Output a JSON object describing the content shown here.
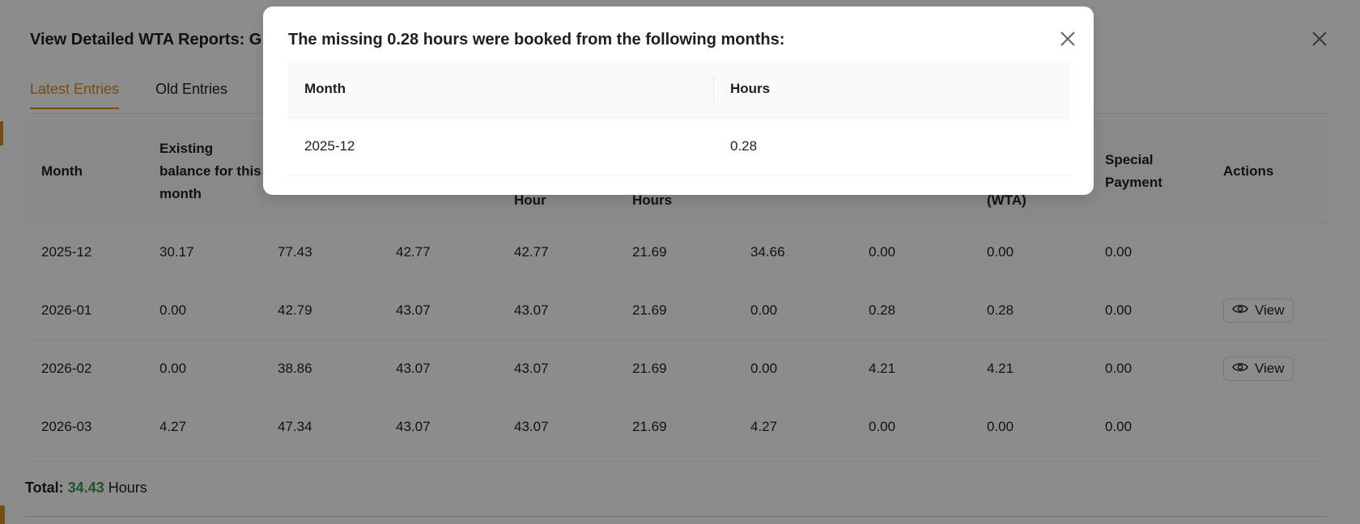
{
  "drawer": {
    "title": "View Detailed WTA Reports: G",
    "tabs": [
      {
        "label": "Latest Entries",
        "active": true
      },
      {
        "label": "Old Entries",
        "active": false
      }
    ],
    "columns": [
      "Month",
      "Existing balance for this month",
      "",
      "",
      "Hour",
      "Hours",
      "",
      "",
      "(WTA)",
      "Special Payment",
      "Actions"
    ],
    "rows": [
      {
        "cells": [
          "2025-12",
          "30.17",
          "77.43",
          "42.77",
          "42.77",
          "21.69",
          "34.66",
          "0.00",
          "0.00",
          "0.00"
        ],
        "action": ""
      },
      {
        "cells": [
          "2026-01",
          "0.00",
          "42.79",
          "43.07",
          "43.07",
          "21.69",
          "0.00",
          "0.28",
          "0.28",
          "0.00"
        ],
        "action": "View"
      },
      {
        "cells": [
          "2026-02",
          "0.00",
          "38.86",
          "43.07",
          "43.07",
          "21.69",
          "0.00",
          "4.21",
          "4.21",
          "0.00"
        ],
        "action": "View"
      },
      {
        "cells": [
          "2026-03",
          "4.27",
          "47.34",
          "43.07",
          "43.07",
          "21.69",
          "4.27",
          "0.00",
          "0.00",
          "0.00"
        ],
        "action": ""
      }
    ],
    "total": {
      "label": "Total:",
      "value": "34.43",
      "unit": "Hours"
    }
  },
  "modal": {
    "title": "The missing 0.28 hours were booked from the following months:",
    "columns": [
      "Month",
      "Hours"
    ],
    "rows": [
      {
        "month": "2025-12",
        "hours": "0.28"
      }
    ]
  },
  "colors": {
    "accent": "#d98c2b",
    "total_value": "#3c9a4e",
    "overlay": "rgba(0,0,0,0.45)"
  }
}
